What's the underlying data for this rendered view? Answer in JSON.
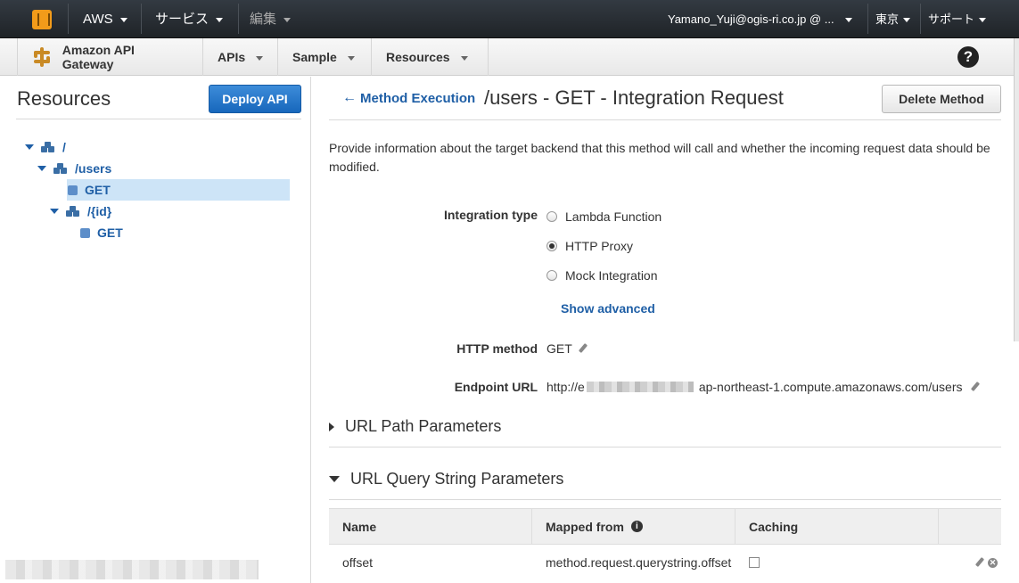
{
  "topbar": {
    "aws_label": "AWS",
    "services_label": "サービス",
    "edit_label": "編集",
    "account_label": "Yamano_Yuji@ogis-ri.co.jp @ ...",
    "region_label": "東京",
    "support_label": "サポート"
  },
  "subnav": {
    "service_name": "Amazon API Gateway",
    "apis_label": "APIs",
    "api_name": "Sample",
    "resources_label": "Resources"
  },
  "left": {
    "title": "Resources",
    "deploy_label": "Deploy API",
    "tree": [
      {
        "label": "/"
      },
      {
        "label": "/users"
      },
      {
        "label": "GET"
      },
      {
        "label": "/{id}"
      },
      {
        "label": "GET"
      }
    ]
  },
  "main": {
    "back_label": "Method Execution",
    "title": "/users - GET - Integration Request",
    "delete_label": "Delete Method",
    "description": "Provide information about the target backend that this method will call and whether the incoming request data should be modified.",
    "integration_type_label": "Integration type",
    "integration_options": [
      {
        "label": "Lambda Function",
        "selected": false
      },
      {
        "label": "HTTP Proxy",
        "selected": true
      },
      {
        "label": "Mock Integration",
        "selected": false
      }
    ],
    "show_advanced_label": "Show advanced",
    "http_method_label": "HTTP method",
    "http_method_value": "GET",
    "endpoint_label": "Endpoint URL",
    "endpoint_prefix": "http://e",
    "endpoint_suffix": "ap-northeast-1.compute.amazonaws.com/users",
    "path_params_label": "URL Path Parameters",
    "query_params_label": "URL Query String Parameters",
    "table": {
      "headers": [
        "Name",
        "Mapped from",
        "Caching"
      ],
      "rows": [
        {
          "name": "offset",
          "mapped_from": "method.request.querystring.offset",
          "caching": false
        }
      ]
    }
  }
}
